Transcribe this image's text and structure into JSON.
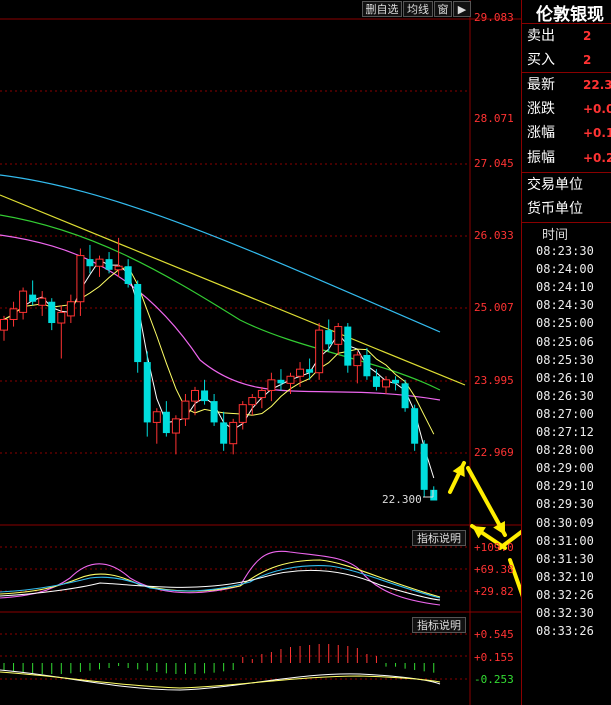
{
  "toolbar": {
    "del_fav": "删自选",
    "ma_line": "均线",
    "window": "窗",
    "arrow": "▶"
  },
  "price_axis": [
    "29.083",
    "28.071",
    "27.045",
    "26.033",
    "25.007",
    "23.995",
    "22.969"
  ],
  "last_price_label": "22.300",
  "indicator_button": "指标说明",
  "ind1_axis": [
    "+109.0",
    "+69.38",
    "+29.82"
  ],
  "ind2_axis": [
    "+0.545",
    "+0.155",
    "-0.253"
  ],
  "quote_panel": {
    "title": "伦敦银现",
    "rows": [
      {
        "label": "卖出",
        "value": "2"
      },
      {
        "label": "买入",
        "value": "2"
      },
      {
        "label": "最新",
        "value": "22.3"
      },
      {
        "label": "涨跌",
        "value": "+0.0"
      },
      {
        "label": "涨幅",
        "value": "+0.1"
      },
      {
        "label": "振幅",
        "value": "+0.2"
      },
      {
        "label": "交易单位",
        "value": ""
      },
      {
        "label": "货币单位",
        "value": ""
      }
    ],
    "time_header": "时间",
    "times": [
      "08:23:30",
      "08:24:00",
      "08:24:10",
      "08:24:30",
      "08:25:00",
      "08:25:06",
      "08:25:30",
      "08:26:10",
      "08:26:30",
      "08:27:00",
      "08:27:12",
      "08:28:00",
      "08:29:00",
      "08:29:10",
      "08:29:30",
      "08:30:09",
      "08:31:00",
      "08:31:30",
      "08:32:10",
      "08:32:26",
      "08:32:30",
      "08:33:26"
    ]
  },
  "colors": {
    "up": "#ff3333",
    "down": "#00dddd",
    "bg": "#000000",
    "grid": "#8a0000",
    "arrow": "#ffee00"
  },
  "chart_data": {
    "type": "candlestick",
    "ylim": [
      22.3,
      29.083
    ],
    "ohlc": [
      [
        24.7,
        24.9,
        24.55,
        24.85
      ],
      [
        24.85,
        25.1,
        24.75,
        25.0
      ],
      [
        24.95,
        25.3,
        24.85,
        25.25
      ],
      [
        25.2,
        25.4,
        25.05,
        25.1
      ],
      [
        25.05,
        25.25,
        24.9,
        25.15
      ],
      [
        25.1,
        25.15,
        24.7,
        24.8
      ],
      [
        24.8,
        25.05,
        24.3,
        24.95
      ],
      [
        24.9,
        25.2,
        24.8,
        25.1
      ],
      [
        25.1,
        25.85,
        24.9,
        25.75
      ],
      [
        25.7,
        25.9,
        25.5,
        25.6
      ],
      [
        25.6,
        25.75,
        25.45,
        25.7
      ],
      [
        25.7,
        25.8,
        25.5,
        25.55
      ],
      [
        25.55,
        26.0,
        25.45,
        25.6
      ],
      [
        25.6,
        25.7,
        25.3,
        25.35
      ],
      [
        25.35,
        25.4,
        24.1,
        24.25
      ],
      [
        24.25,
        24.4,
        23.2,
        23.4
      ],
      [
        23.4,
        23.6,
        23.1,
        23.55
      ],
      [
        23.55,
        23.7,
        23.2,
        23.25
      ],
      [
        23.25,
        23.5,
        22.95,
        23.45
      ],
      [
        23.45,
        23.8,
        23.35,
        23.7
      ],
      [
        23.7,
        23.9,
        23.5,
        23.85
      ],
      [
        23.85,
        24.0,
        23.65,
        23.7
      ],
      [
        23.7,
        23.8,
        23.35,
        23.4
      ],
      [
        23.4,
        23.55,
        23.0,
        23.1
      ],
      [
        23.1,
        23.45,
        22.95,
        23.4
      ],
      [
        23.4,
        23.7,
        23.3,
        23.65
      ],
      [
        23.65,
        23.8,
        23.5,
        23.75
      ],
      [
        23.75,
        23.9,
        23.6,
        23.85
      ],
      [
        23.85,
        24.1,
        23.7,
        24.0
      ],
      [
        24.0,
        24.15,
        23.85,
        23.95
      ],
      [
        23.95,
        24.1,
        23.8,
        24.05
      ],
      [
        24.05,
        24.25,
        23.9,
        24.15
      ],
      [
        24.15,
        24.3,
        24.0,
        24.1
      ],
      [
        24.1,
        24.8,
        24.0,
        24.7
      ],
      [
        24.7,
        24.85,
        24.4,
        24.5
      ],
      [
        24.5,
        24.8,
        24.35,
        24.75
      ],
      [
        24.75,
        24.8,
        24.1,
        24.2
      ],
      [
        24.2,
        24.4,
        23.95,
        24.35
      ],
      [
        24.35,
        24.45,
        24.0,
        24.05
      ],
      [
        24.05,
        24.15,
        23.85,
        23.9
      ],
      [
        23.9,
        24.05,
        23.8,
        24.0
      ],
      [
        24.0,
        24.05,
        23.85,
        23.95
      ],
      [
        23.95,
        24.0,
        23.55,
        23.6
      ],
      [
        23.6,
        23.65,
        23.0,
        23.1
      ],
      [
        23.1,
        23.15,
        22.35,
        22.45
      ],
      [
        22.45,
        22.5,
        22.3,
        22.3
      ]
    ]
  }
}
